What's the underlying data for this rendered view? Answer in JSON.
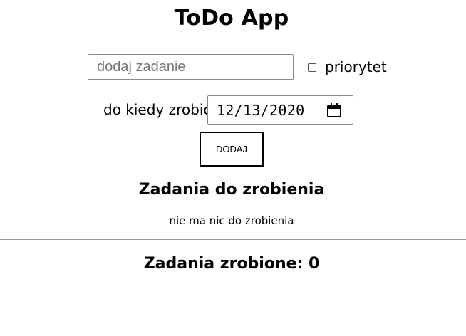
{
  "app": {
    "title": "ToDo App"
  },
  "form": {
    "task_placeholder": "dodaj zadanie",
    "task_value": "",
    "priority_label": "priorytet",
    "priority_checked": false,
    "date_label": "do kiedy zrobić",
    "date_value": "12/13/2020",
    "add_button_label": "DODAJ",
    "icons": {
      "date_picker": "calendar-icon"
    }
  },
  "todo_section": {
    "heading": "Zadania do zrobienia",
    "empty_message": "nie ma nic do zrobienia"
  },
  "done_section": {
    "heading": "Zadania zrobione: 0"
  }
}
